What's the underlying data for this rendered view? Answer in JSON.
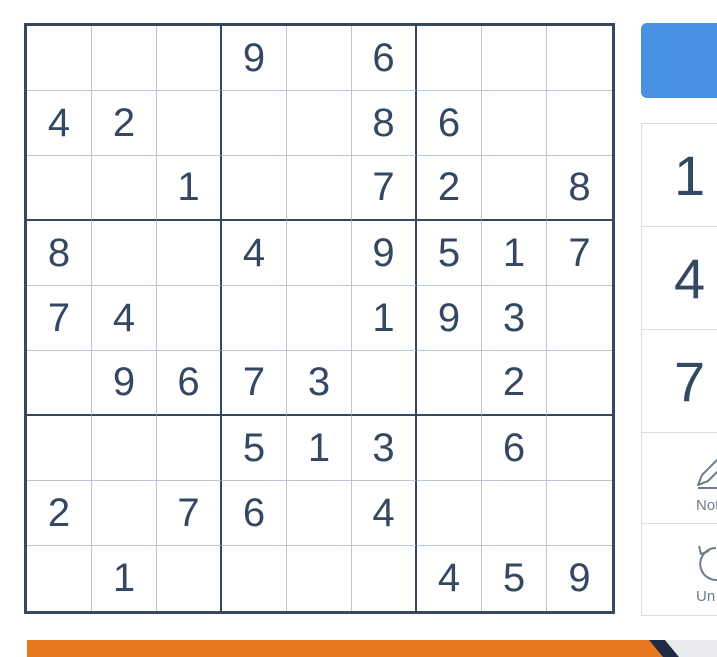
{
  "board": {
    "rows": [
      [
        "",
        "",
        "",
        "9",
        "",
        "6",
        "",
        "",
        ""
      ],
      [
        "4",
        "2",
        "",
        "",
        "",
        "8",
        "6",
        "",
        ""
      ],
      [
        "",
        "",
        "1",
        "",
        "",
        "7",
        "2",
        "",
        "8"
      ],
      [
        "8",
        "",
        "",
        "4",
        "",
        "9",
        "5",
        "1",
        "7"
      ],
      [
        "7",
        "4",
        "",
        "",
        "",
        "1",
        "9",
        "3",
        ""
      ],
      [
        "",
        "9",
        "6",
        "7",
        "3",
        "",
        "",
        "2",
        ""
      ],
      [
        "",
        "",
        "",
        "5",
        "1",
        "3",
        "",
        "6",
        ""
      ],
      [
        "2",
        "",
        "7",
        "6",
        "",
        "4",
        "",
        "",
        ""
      ],
      [
        "",
        "1",
        "",
        "",
        "",
        "",
        "4",
        "5",
        "9"
      ]
    ]
  },
  "numpad": {
    "keys": [
      "1",
      "4",
      "7"
    ]
  },
  "tools": {
    "notes_label": "Not",
    "undo_label": "Un"
  },
  "colors": {
    "digit": "#344861",
    "grid_thick": "#344861",
    "grid_thin": "#bec6d4",
    "accent_blue": "#4a90e2",
    "banner_orange": "#e87722",
    "banner_navy": "#1f2a44"
  },
  "icons": {
    "notes": "pencil-icon",
    "undo": "undo-arrow-icon"
  }
}
